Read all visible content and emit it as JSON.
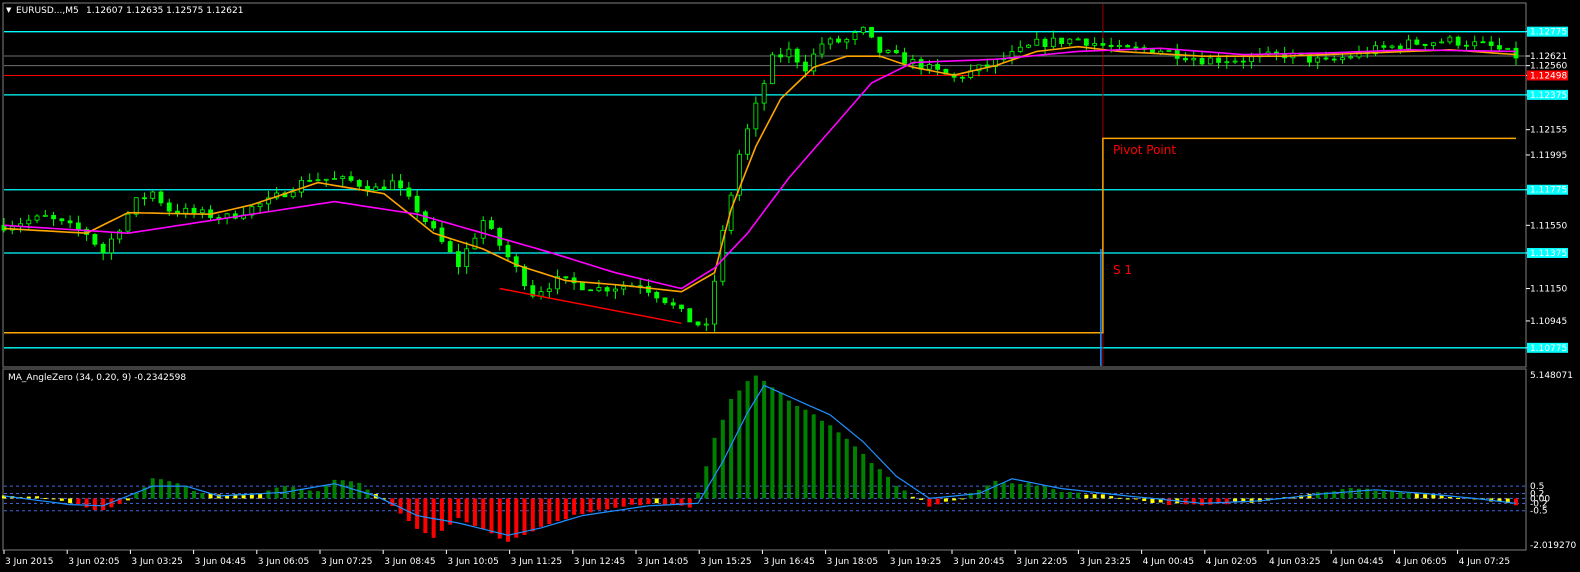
{
  "header": {
    "symbol": "EURUSD...,M5",
    "ohlc": "1.12607 1.12635 1.12575 1.12621"
  },
  "indicator": {
    "label": "MA_AngleZero (34, 0.20, 9) -0.2342598",
    "ymax_label": "5.148071",
    "ymin_label": "-2.019270",
    "levels": [
      "0.5",
      "0.2",
      "0.00",
      "-0.2",
      "-0.5"
    ]
  },
  "annotations": {
    "pivot": "Pivot Point",
    "s1": "S 1"
  },
  "colors": {
    "background": "#000000",
    "bull_candle": "#00ff00",
    "level_line": "#00ffff",
    "price_ma_orange": "#ffa500",
    "price_ma_magenta": "#ff00ff",
    "red_line": "#ff0000",
    "hist_green": "#008000",
    "hist_red": "#ff0000",
    "hist_yellow": "#ffff00",
    "signal_line": "#1e90ff",
    "level_dashed": "#4169e1"
  },
  "chart_data": [
    {
      "type": "candlestick",
      "title": "EURUSD...,M5",
      "ylim": [
        1.1066,
        1.1295
      ],
      "y_ticks": [
        "1.12775",
        "1.12621",
        "1.12560",
        "1.12498",
        "1.12375",
        "1.12155",
        "1.11995",
        "1.11775",
        "1.11550",
        "1.11375",
        "1.11150",
        "1.10945",
        "1.10775"
      ],
      "x_labels": [
        "3 Jun 2015",
        "3 Jun 02:05",
        "3 Jun 03:25",
        "3 Jun 04:45",
        "3 Jun 06:05",
        "3 Jun 07:25",
        "3 Jun 08:45",
        "3 Jun 10:05",
        "3 Jun 11:25",
        "3 Jun 12:45",
        "3 Jun 14:05",
        "3 Jun 15:25",
        "3 Jun 16:45",
        "3 Jun 18:05",
        "3 Jun 19:25",
        "3 Jun 20:45",
        "3 Jun 22:05",
        "3 Jun 23:25",
        "4 Jun 00:45",
        "4 Jun 02:05",
        "4 Jun 03:25",
        "4 Jun 04:45",
        "4 Jun 06:05",
        "4 Jun 07:25"
      ],
      "close_path": [
        [
          0,
          1.1155
        ],
        [
          5,
          1.116
        ],
        [
          10,
          1.115
        ],
        [
          12,
          1.1138
        ],
        [
          16,
          1.117
        ],
        [
          18,
          1.1176
        ],
        [
          20,
          1.1165
        ],
        [
          27,
          1.116
        ],
        [
          32,
          1.117
        ],
        [
          37,
          1.1185
        ],
        [
          42,
          1.1183
        ],
        [
          45,
          1.1178
        ],
        [
          47,
          1.1182
        ],
        [
          50,
          1.1165
        ],
        [
          55,
          1.113
        ],
        [
          58,
          1.1158
        ],
        [
          61,
          1.1135
        ],
        [
          64,
          1.1112
        ],
        [
          67,
          1.112
        ],
        [
          72,
          1.1115
        ],
        [
          77,
          1.1118
        ],
        [
          80,
          1.1108
        ],
        [
          83,
          1.1095
        ],
        [
          85,
          1.109
        ],
        [
          87,
          1.115
        ],
        [
          89,
          1.12
        ],
        [
          91,
          1.123
        ],
        [
          93,
          1.126
        ],
        [
          95,
          1.1265
        ],
        [
          97,
          1.1255
        ],
        [
          99,
          1.127
        ],
        [
          102,
          1.1272
        ],
        [
          104,
          1.1278
        ],
        [
          106,
          1.1265
        ],
        [
          110,
          1.1258
        ],
        [
          115,
          1.1248
        ],
        [
          120,
          1.1258
        ],
        [
          125,
          1.127
        ],
        [
          130,
          1.1273
        ],
        [
          135,
          1.1266
        ],
        [
          140,
          1.1266
        ],
        [
          145,
          1.126
        ],
        [
          150,
          1.126
        ],
        [
          155,
          1.1263
        ],
        [
          160,
          1.1258
        ],
        [
          165,
          1.1265
        ],
        [
          170,
          1.127
        ],
        [
          175,
          1.1272
        ],
        [
          180,
          1.1268
        ],
        [
          183,
          1.1262
        ]
      ],
      "levels_cyan": [
        1.12775,
        1.12375,
        1.11775,
        1.11375,
        1.10775
      ],
      "level_red": 1.12498,
      "level_gray": [
        1.12621,
        1.1256
      ],
      "pivot_step": {
        "left_value": 1.1087,
        "right_value": 1.121,
        "split_index": 133
      },
      "series": [
        {
          "name": "",
          "kind": "ma_orange",
          "path": [
            [
              0,
              1.1153
            ],
            [
              10,
              1.115
            ],
            [
              15,
              1.1163
            ],
            [
              25,
              1.1162
            ],
            [
              30,
              1.1168
            ],
            [
              38,
              1.1182
            ],
            [
              46,
              1.1175
            ],
            [
              52,
              1.115
            ],
            [
              58,
              1.114
            ],
            [
              62,
              1.113
            ],
            [
              68,
              1.112
            ],
            [
              75,
              1.1117
            ],
            [
              82,
              1.1113
            ],
            [
              86,
              1.1125
            ],
            [
              88,
              1.1165
            ],
            [
              91,
              1.1205
            ],
            [
              94,
              1.1235
            ],
            [
              98,
              1.1255
            ],
            [
              102,
              1.1262
            ],
            [
              106,
              1.1262
            ],
            [
              110,
              1.1255
            ],
            [
              115,
              1.125
            ],
            [
              120,
              1.1256
            ],
            [
              125,
              1.1265
            ],
            [
              130,
              1.1268
            ],
            [
              135,
              1.1265
            ],
            [
              145,
              1.1262
            ],
            [
              155,
              1.1262
            ],
            [
              165,
              1.1264
            ],
            [
              175,
              1.1266
            ],
            [
              183,
              1.1263
            ]
          ]
        },
        {
          "name": "",
          "kind": "ma_magenta",
          "path": [
            [
              0,
              1.1155
            ],
            [
              15,
              1.115
            ],
            [
              30,
              1.1162
            ],
            [
              40,
              1.117
            ],
            [
              50,
              1.1162
            ],
            [
              58,
              1.115
            ],
            [
              66,
              1.1138
            ],
            [
              74,
              1.1125
            ],
            [
              82,
              1.1115
            ],
            [
              86,
              1.1128
            ],
            [
              90,
              1.115
            ],
            [
              95,
              1.1185
            ],
            [
              100,
              1.1215
            ],
            [
              105,
              1.1245
            ],
            [
              110,
              1.1258
            ],
            [
              115,
              1.1259
            ],
            [
              120,
              1.126
            ],
            [
              130,
              1.1265
            ],
            [
              140,
              1.1267
            ],
            [
              150,
              1.1263
            ],
            [
              160,
              1.1264
            ],
            [
              170,
              1.1266
            ],
            [
              183,
              1.1265
            ]
          ]
        }
      ],
      "red_trendline": [
        [
          60,
          1.1115
        ],
        [
          82,
          1.1093
        ]
      ]
    },
    {
      "type": "histogram",
      "title": "MA_AngleZero (34, 0.20, 9) -0.2342598",
      "ylim": [
        -2.01927,
        5.148071
      ],
      "levels": [
        0.5,
        0.2,
        0.0,
        -0.2,
        -0.5
      ],
      "histogram_path": [
        [
          0,
          0.1
        ],
        [
          5,
          0.05
        ],
        [
          8,
          -0.2
        ],
        [
          12,
          -0.5
        ],
        [
          15,
          -0.1
        ],
        [
          18,
          0.8
        ],
        [
          21,
          0.6
        ],
        [
          24,
          0.2
        ],
        [
          30,
          0.1
        ],
        [
          34,
          0.5
        ],
        [
          38,
          0.3
        ],
        [
          40,
          0.8
        ],
        [
          43,
          0.6
        ],
        [
          45,
          0.2
        ],
        [
          47,
          -0.3
        ],
        [
          50,
          -1.2
        ],
        [
          52,
          -1.6
        ],
        [
          55,
          -0.8
        ],
        [
          58,
          -1.3
        ],
        [
          61,
          -1.8
        ],
        [
          63,
          -1.5
        ],
        [
          66,
          -1.0
        ],
        [
          70,
          -0.6
        ],
        [
          75,
          -0.3
        ],
        [
          80,
          -0.2
        ],
        [
          83,
          -0.4
        ],
        [
          84,
          0.2
        ],
        [
          86,
          2.5
        ],
        [
          88,
          4.0
        ],
        [
          90,
          4.8
        ],
        [
          91,
          5.0
        ],
        [
          93,
          4.5
        ],
        [
          96,
          3.8
        ],
        [
          100,
          3.0
        ],
        [
          104,
          1.8
        ],
        [
          108,
          0.5
        ],
        [
          110,
          0.1
        ],
        [
          112,
          -0.3
        ],
        [
          116,
          0.0
        ],
        [
          120,
          0.7
        ],
        [
          124,
          0.6
        ],
        [
          128,
          0.3
        ],
        [
          134,
          0.1
        ],
        [
          140,
          -0.2
        ],
        [
          145,
          -0.3
        ],
        [
          152,
          -0.1
        ],
        [
          158,
          0.2
        ],
        [
          163,
          0.4
        ],
        [
          168,
          0.3
        ],
        [
          174,
          0.1
        ],
        [
          180,
          -0.1
        ],
        [
          183,
          -0.3
        ]
      ],
      "signal_path": [
        [
          0,
          0.1
        ],
        [
          8,
          -0.25
        ],
        [
          12,
          -0.3
        ],
        [
          18,
          0.5
        ],
        [
          22,
          0.5
        ],
        [
          26,
          0.1
        ],
        [
          34,
          0.25
        ],
        [
          40,
          0.6
        ],
        [
          45,
          0.1
        ],
        [
          50,
          -0.7
        ],
        [
          55,
          -1.0
        ],
        [
          61,
          -1.5
        ],
        [
          65,
          -1.2
        ],
        [
          70,
          -0.7
        ],
        [
          78,
          -0.3
        ],
        [
          84,
          -0.2
        ],
        [
          87,
          1.5
        ],
        [
          90,
          3.5
        ],
        [
          92,
          4.6
        ],
        [
          96,
          4.0
        ],
        [
          100,
          3.4
        ],
        [
          104,
          2.3
        ],
        [
          108,
          0.9
        ],
        [
          112,
          0.0
        ],
        [
          118,
          0.2
        ],
        [
          122,
          0.8
        ],
        [
          128,
          0.4
        ],
        [
          136,
          0.1
        ],
        [
          145,
          -0.2
        ],
        [
          152,
          -0.1
        ],
        [
          160,
          0.2
        ],
        [
          166,
          0.35
        ],
        [
          172,
          0.2
        ],
        [
          178,
          0.0
        ],
        [
          183,
          -0.2
        ]
      ]
    }
  ]
}
